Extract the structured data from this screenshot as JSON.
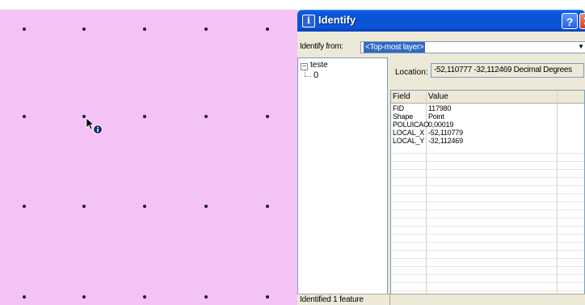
{
  "window": {
    "title": "Identify",
    "help_label": "?",
    "close_label": "✕"
  },
  "identify_from": {
    "label": "Identify from:",
    "value": "<Top-most layer>"
  },
  "tree": {
    "root_label": "teste",
    "child_label": "0",
    "toggle_glyph": "−"
  },
  "location": {
    "label": "Location:",
    "value": "-52,110777  -32,112469 Decimal Degrees"
  },
  "attributes": {
    "columns": [
      "Field",
      "Value"
    ],
    "rows": [
      {
        "field": "FID",
        "value": "117980"
      },
      {
        "field": "Shape",
        "value": "Point"
      },
      {
        "field": "POLUICAO",
        "value": "0,00019"
      },
      {
        "field": "LOCAL_X",
        "value": "-52,110779"
      },
      {
        "field": "LOCAL_Y",
        "value": "-32,112469"
      }
    ]
  },
  "status": {
    "text": "Identified 1 feature"
  },
  "map": {
    "background_color": "#f4c2f4",
    "point_color": "#1a1a3a"
  },
  "icons": {
    "title_icon": "info-icon",
    "cursor": "identify-cursor-icon"
  }
}
